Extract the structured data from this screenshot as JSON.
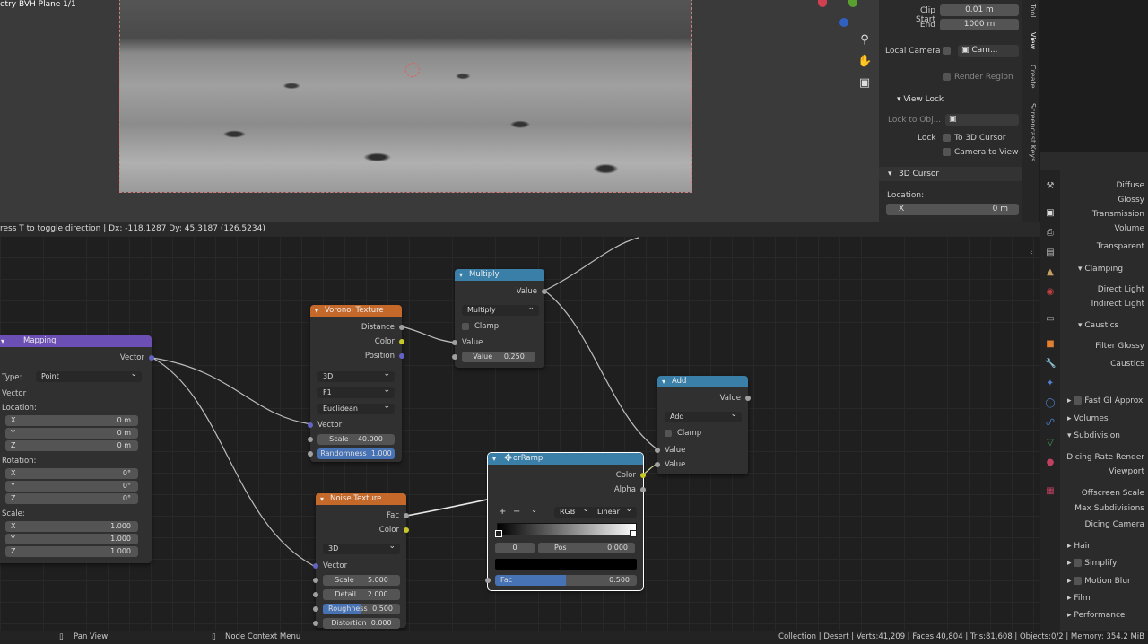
{
  "viewport": {
    "title": "etry BVH Plane 1/1"
  },
  "npanel": {
    "clip_start_label": "Clip Start",
    "clip_start_value": "0.01 m",
    "end_label": "End",
    "end_value": "1000 m",
    "local_camera_label": "Local Camera",
    "local_camera_value": "Cam...",
    "render_region_label": "Render Region",
    "view_lock_header": "View Lock",
    "lock_to_obj_label": "Lock to Obj...",
    "lock_label": "Lock",
    "to_3d_cursor_label": "To 3D Cursor",
    "camera_to_view_label": "Camera to View",
    "cursor_header": "3D Cursor",
    "location_label": "Location:",
    "x_label": "X",
    "x_value": "0 m",
    "tabs": [
      "Tool",
      "View",
      "Create",
      "Screencast Keys"
    ]
  },
  "hint": {
    "text": "ress T to toggle direction  |  Dx: -118.1287   Dy: 45.3187 (126.5234)"
  },
  "nodes": {
    "mapping": {
      "title": "Mapping",
      "vector_out": "Vector",
      "type_label": "Type:",
      "type_value": "Point",
      "vector_label": "Vector",
      "location_label": "Location:",
      "rotation_label": "Rotation:",
      "scale_label": "Scale:",
      "loc": [
        {
          "axis": "X",
          "value": "0 m"
        },
        {
          "axis": "Y",
          "value": "0 m"
        },
        {
          "axis": "Z",
          "value": "0 m"
        }
      ],
      "rot": [
        {
          "axis": "X",
          "value": "0°"
        },
        {
          "axis": "Y",
          "value": "0°"
        },
        {
          "axis": "Z",
          "value": "0°"
        }
      ],
      "scale": [
        {
          "axis": "X",
          "value": "1.000"
        },
        {
          "axis": "Y",
          "value": "1.000"
        },
        {
          "axis": "Z",
          "value": "1.000"
        }
      ]
    },
    "voronoi": {
      "title": "Voronoi Texture",
      "distance": "Distance",
      "color": "Color",
      "position": "Position",
      "dim": "3D",
      "feature": "F1",
      "metric": "Euclidean",
      "vector": "Vector",
      "scale_label": "Scale",
      "scale_value": "40.000",
      "rand_label": "Randomness",
      "rand_value": "1.000"
    },
    "multiply": {
      "title": "Multiply",
      "value_out": "Value",
      "op": "Multiply",
      "clamp": "Clamp",
      "value_in": "Value",
      "value2_label": "Value",
      "value2_value": "0.250"
    },
    "add": {
      "title": "Add",
      "value_out": "Value",
      "op": "Add",
      "clamp": "Clamp",
      "value_a": "Value",
      "value_b": "Value"
    },
    "noise": {
      "title": "Noise Texture",
      "fac": "Fac",
      "color": "Color",
      "dim": "3D",
      "vector": "Vector",
      "scale_label": "Scale",
      "scale_value": "5.000",
      "detail_label": "Detail",
      "detail_value": "2.000",
      "rough_label": "Roughness",
      "rough_value": "0.500",
      "distortion_label": "Distortion",
      "distortion_value": "0.000"
    },
    "colorramp": {
      "title": "orRamp",
      "color": "Color",
      "alpha": "Alpha",
      "plus": "+",
      "minus": "−",
      "mode": "RGB",
      "interp": "Linear",
      "index": "0",
      "pos_label": "Pos",
      "pos_value": "0.000",
      "fac_label": "Fac",
      "fac_value": "0.500",
      "fac_fraction": 0.5
    }
  },
  "props": {
    "items": [
      {
        "label": "Diffuse",
        "y": 0
      },
      {
        "label": "Glossy"
      },
      {
        "label": "Transmission"
      },
      {
        "label": "Volume"
      },
      {
        "label": "Transparent"
      }
    ],
    "clamping_header": "Clamping",
    "direct_light": "Direct Light",
    "indirect_light": "Indirect Light",
    "caustics_header": "Caustics",
    "filter_glossy": "Filter Glossy",
    "caustics": "Caustics",
    "fast_gi": "Fast GI Approx",
    "volumes": "Volumes",
    "subdivision": "Subdivision",
    "dicing_render": "Dicing Rate Render",
    "viewport": "Viewport",
    "offscreen_scale": "Offscreen Scale",
    "max_subdiv": "Max Subdivisions",
    "dicing_camera": "Dicing Camera",
    "hair": "Hair",
    "simplify": "Simplify",
    "motion_blur": "Motion Blur",
    "film": "Film",
    "performance": "Performance"
  },
  "status": {
    "pan_view": "Pan View",
    "node_context": "Node Context Menu",
    "stats": "Collection | Desert | Verts:41,209 | Faces:40,804 | Tris:81,608 | Objects:0/2 | Memory: 354.2 MiB"
  }
}
